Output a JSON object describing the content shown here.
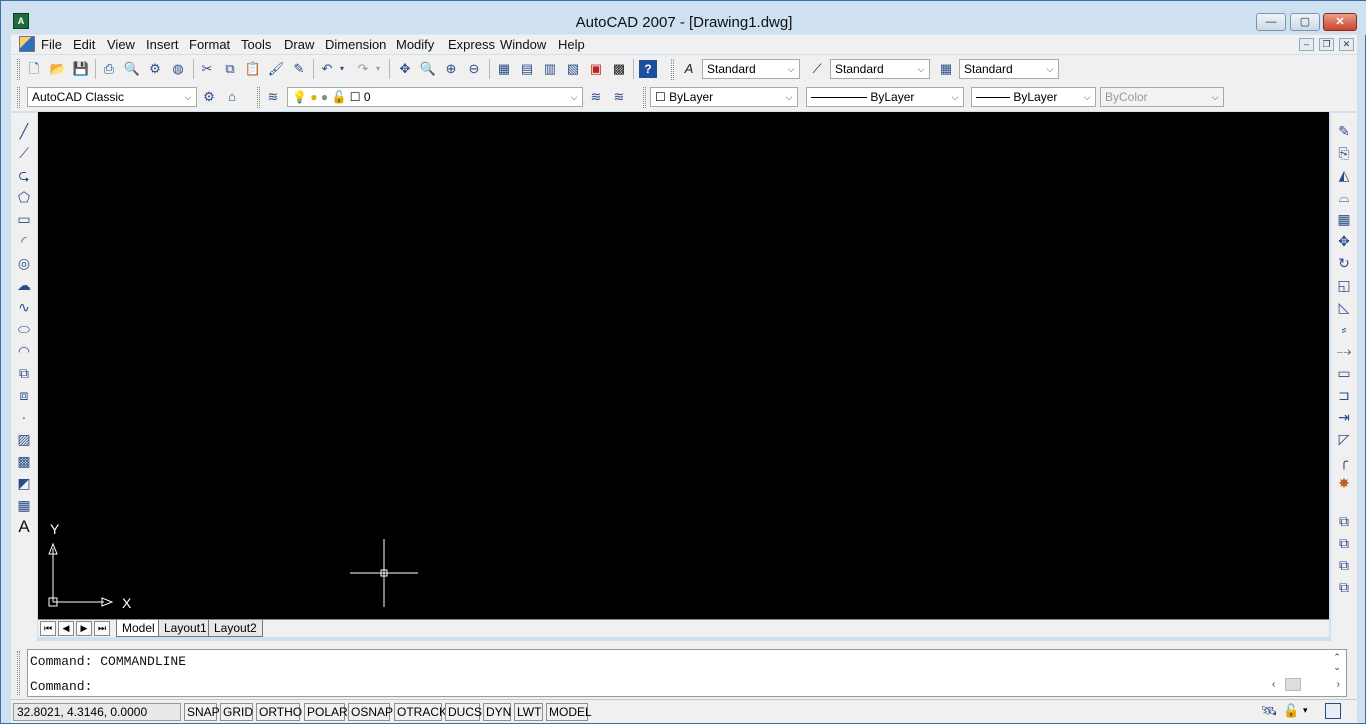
{
  "window": {
    "title": "AutoCAD 2007 - [Drawing1.dwg]",
    "min": "—",
    "max": "▢",
    "close": "✕"
  },
  "menu": [
    "File",
    "Edit",
    "View",
    "Insert",
    "Format",
    "Tools",
    "Draw",
    "Dimension",
    "Modify",
    "Express",
    "Window",
    "Help"
  ],
  "toolbar1": {
    "text_style": "Standard",
    "dim_style": "Standard",
    "table_style": "Standard"
  },
  "toolbar2": {
    "workspace": "AutoCAD Classic",
    "layer": "0",
    "color": "ByLayer",
    "linetype": "ByLayer",
    "lineweight": "ByLayer",
    "plotstyle": "ByColor"
  },
  "ucs": {
    "x_label": "X",
    "y_label": "Y"
  },
  "layout_tabs": [
    "Model",
    "Layout1",
    "Layout2"
  ],
  "command": {
    "history": "Command: COMMANDLINE",
    "prompt": "Command:"
  },
  "status": {
    "coords": "32.8021, 4.3146, 0.0000",
    "toggles": [
      "SNAP",
      "GRID",
      "ORTHO",
      "POLAR",
      "OSNAP",
      "OTRACK",
      "DUCS",
      "DYN",
      "LWT",
      "MODEL"
    ]
  },
  "icons": {
    "draw": [
      "line-icon",
      "construction-line-icon",
      "polyline-icon",
      "polygon-icon",
      "rectangle-icon",
      "arc-icon",
      "circle-icon",
      "revision-cloud-icon",
      "spline-icon",
      "ellipse-icon",
      "ellipse-arc-icon",
      "insert-block-icon",
      "make-block-icon",
      "point-icon",
      "hatch-icon",
      "gradient-icon",
      "region-icon",
      "table-icon",
      "multiline-text-icon"
    ],
    "modify": [
      "erase-icon",
      "copy-icon",
      "mirror-icon",
      "offset-icon",
      "array-icon",
      "move-icon",
      "rotate-icon",
      "scale-icon",
      "stretch-icon",
      "trim-icon",
      "extend-icon",
      "break-at-point-icon",
      "break-icon",
      "join-icon",
      "chamfer-icon",
      "fillet-icon",
      "explode-icon",
      "draworder-front-icon",
      "draworder-back-icon",
      "draworder-above-icon",
      "draworder-under-icon"
    ]
  }
}
